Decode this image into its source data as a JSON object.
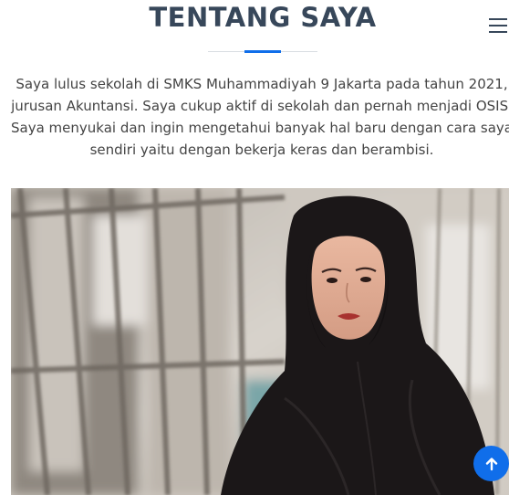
{
  "section": {
    "title": "TENTANG SAYA",
    "accent_color": "#106eea",
    "title_color": "#37475a"
  },
  "about": {
    "paragraph": "Saya lulus sekolah di SMKS Muhammadiyah 9 Jakarta pada tahun 2021, jurusan Akuntansi. Saya cukup aktif di sekolah dan pernah menjadi OSIS. Saya menyukai dan ingin mengetahui banyak hal baru dengan cara saya sendiri yaitu dengan bekerja keras dan berambisi."
  },
  "nav": {
    "menu_icon": "hamburger-menu-icon"
  },
  "photo": {
    "subject": "woman-in-black-hijab-portrait"
  },
  "back_to_top": {
    "icon": "arrow-up-icon"
  }
}
